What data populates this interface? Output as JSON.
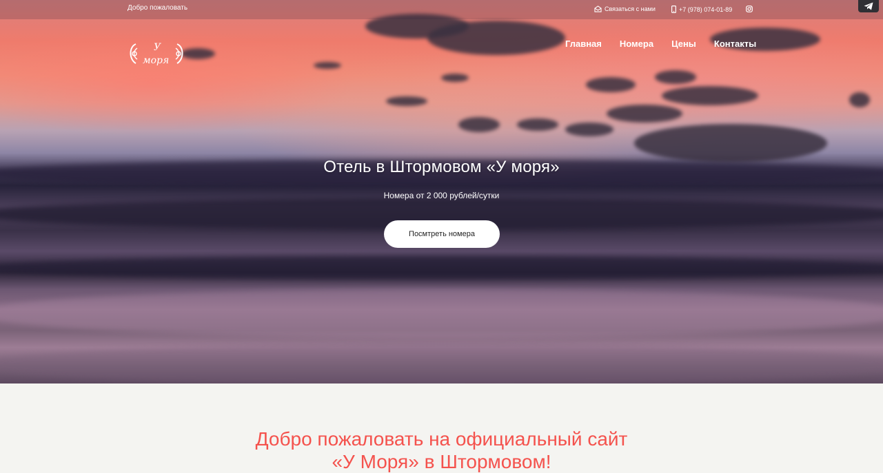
{
  "topbar": {
    "welcome": "Добро пожаловать",
    "contact_label": "Связаться с нами",
    "phone": "+7 (978) 074-01-89",
    "icons": [
      "envelope-open-icon",
      "mobile-phone-icon",
      "instagram-icon",
      "telegram-icon"
    ]
  },
  "logo": {
    "text_line1": "У",
    "text_line2": "моря"
  },
  "nav": {
    "items": [
      {
        "label": "Главная"
      },
      {
        "label": "Номера"
      },
      {
        "label": "Цены"
      },
      {
        "label": "Контакты"
      }
    ]
  },
  "hero": {
    "title": "Отель в Штормовом «У моря»",
    "subtitle": "Номера от 2 000 рублей/сутки",
    "cta_label": "Посмтреть номера"
  },
  "section": {
    "title_line1": "Добро пожаловать на официальный сайт",
    "title_line2": "«У Моря» в Штормовом!"
  },
  "colors": {
    "accent": "#f4524d",
    "page_bg": "#f4f4f1",
    "button_bg": "#ffffff"
  }
}
